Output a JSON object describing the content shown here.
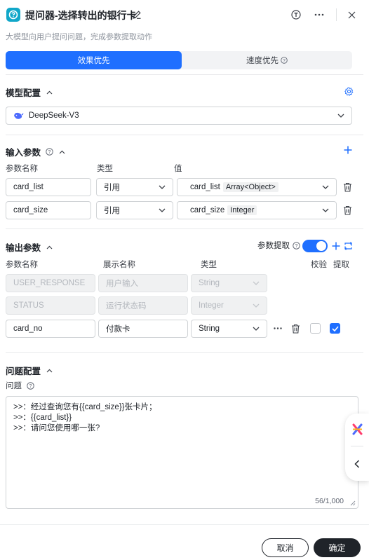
{
  "header": {
    "title": "提问器-选择转出的银行卡",
    "subtitle": "大模型向用户提问问题，完成参数提取动作"
  },
  "tabs": [
    {
      "label": "效果优先",
      "active": true
    },
    {
      "label": "速度优先",
      "active": false
    }
  ],
  "model": {
    "section_title": "模型配置",
    "selected": "DeepSeek-V3"
  },
  "inputs": {
    "section_title": "输入参数",
    "headers": {
      "name": "参数名称",
      "type": "类型",
      "value": "值"
    },
    "rows": [
      {
        "name": "card_list",
        "type": "引用",
        "ref": "card_list",
        "ref_type": "Array<Object>"
      },
      {
        "name": "card_size",
        "type": "引用",
        "ref": "card_size",
        "ref_type": "Integer"
      }
    ]
  },
  "outputs": {
    "section_title": "输出参数",
    "extract_label": "参数提取",
    "extract_on": true,
    "headers": {
      "name": "参数名称",
      "display": "展示名称",
      "type": "类型",
      "validate": "校验",
      "extract": "提取"
    },
    "rows": [
      {
        "name": "USER_RESPONSE",
        "display": "用户输入",
        "type": "String",
        "disabled": true
      },
      {
        "name": "STATUS",
        "display": "运行状态码",
        "type": "Integer",
        "disabled": true
      },
      {
        "name": "card_no",
        "display": "付款卡",
        "type": "String",
        "disabled": false,
        "validate": false,
        "extract": true
      }
    ]
  },
  "question": {
    "section_title": "问题配置",
    "label": "问题",
    "lines": [
      ">>：经过查询您有{{card_size}}张卡片；",
      ">>：{{card_list}}",
      ">>：请问您使用哪一张?"
    ],
    "counter": "56/1,000"
  },
  "footer": {
    "cancel": "取消",
    "confirm": "确定"
  },
  "colors": {
    "accent": "#1f6fff",
    "brand": "#11a7c9",
    "dark": "#1f2329"
  }
}
